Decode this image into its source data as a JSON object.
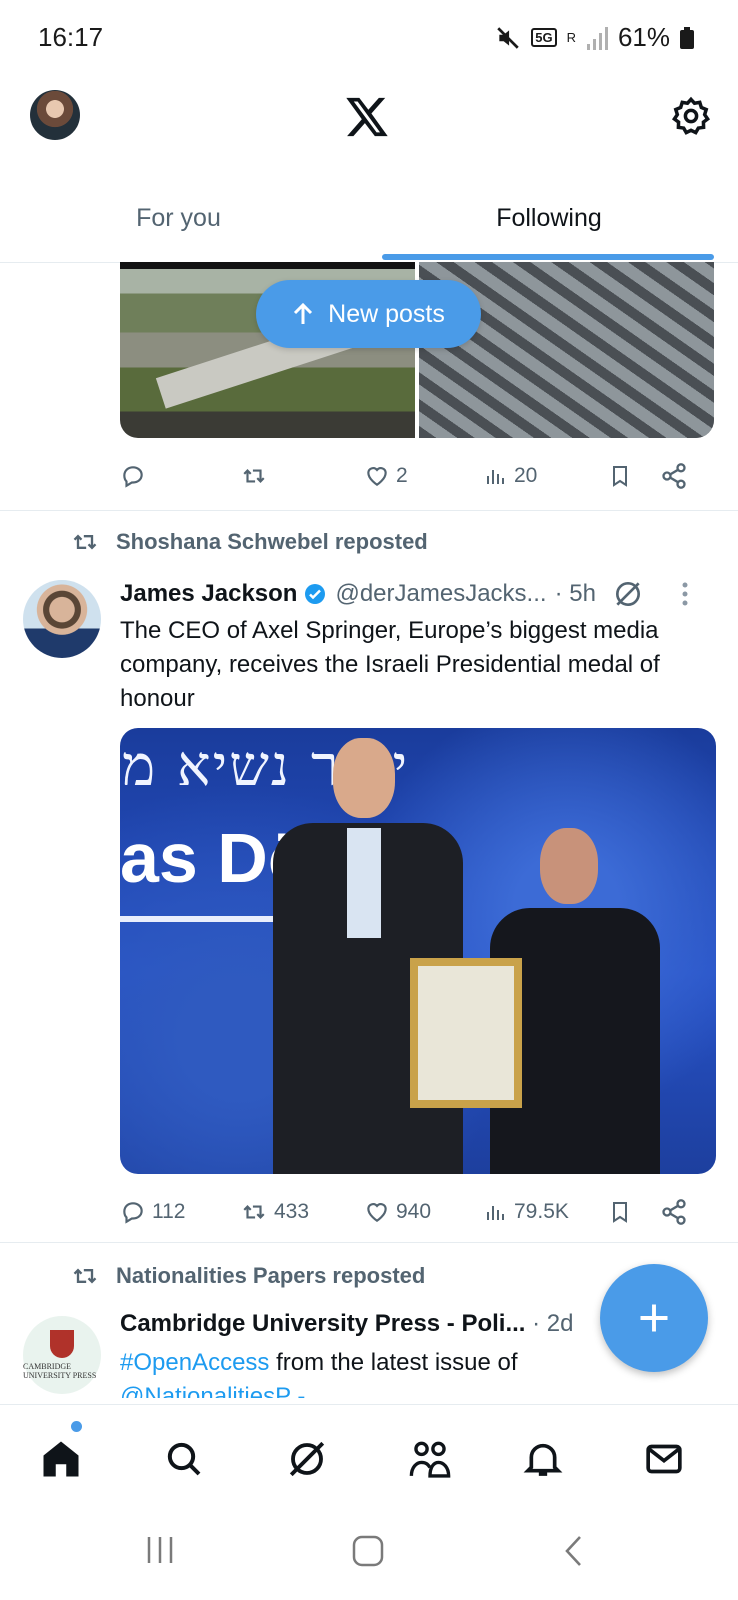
{
  "status_bar": {
    "time": "16:17",
    "network": "5G",
    "roaming": "R",
    "battery": "61%"
  },
  "header": {
    "tabs": [
      "For you",
      "Following"
    ],
    "selected_tab": "Following"
  },
  "new_posts_pill": {
    "label": "New posts"
  },
  "post1_actions": {
    "reply": "",
    "repost": "",
    "likes": "2",
    "views": "20"
  },
  "post2": {
    "repost_by": "Shoshana Schwebel reposted",
    "author": "James Jackson",
    "handle": "@derJamesJacks...",
    "time": "· 5h",
    "text": "The CEO of Axel Springer, Europe’s biggest media company, receives the Israeli Presidential medal of honour",
    "image_text_hebrew": "יטור נשיא מ",
    "image_text_stage": "as Dön er",
    "actions": {
      "replies": "112",
      "reposts": "433",
      "likes": "940",
      "views": "79.5K"
    }
  },
  "post3": {
    "repost_by": "Nationalities Papers reposted",
    "author": "Cambridge University Press - Poli...",
    "time": "· 2d",
    "hashtag": "#OpenAccess",
    "text_rest": " from the latest issue of",
    "mention": "@NationalitiesP -",
    "avatar_label": "CAMBRIDGE UNIVERSITY PRESS"
  },
  "colors": {
    "accent": "#4a9be8",
    "secondary_text": "#536471",
    "verified": "#1d9bf0"
  },
  "icons": [
    "home-icon",
    "search-icon",
    "grok-icon",
    "communities-icon",
    "notifications-icon",
    "messages-icon",
    "gear-icon",
    "x-logo-icon"
  ]
}
